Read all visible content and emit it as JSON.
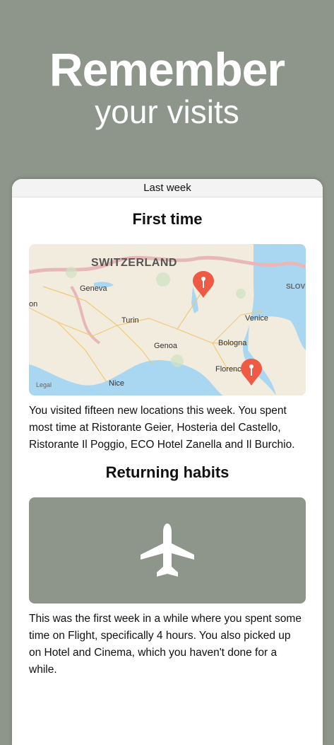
{
  "headline": {
    "line1": "Remember",
    "line2": "your visits"
  },
  "card": {
    "header": "Last week",
    "first_time": {
      "title": "First time",
      "map": {
        "country_label": "SWITZERLAND",
        "cities": [
          "Geneva",
          "Turin",
          "Genoa",
          "Nice",
          "Bologna",
          "Florence",
          "Venice"
        ],
        "partial_labels": [
          "on",
          "SLOVE",
          "Legal"
        ],
        "pins": 2
      },
      "description": "You visited fifteen new locations this week. You spent most time at Ristorante Geier, Hosteria del Castello, Ristorante Il Poggio, ECO Hotel Zanella and Il Burchio."
    },
    "returning": {
      "title": "Returning habits",
      "icon": "airplane-icon",
      "description": "This was the first week in a while where you spent some time on Flight, specifically 4 hours. You also picked up on Hotel and Cinema, which you haven't done for a while."
    }
  },
  "colors": {
    "background": "#8e958a",
    "pin": "#ee5a44",
    "water": "#a9d7f1",
    "land": "#f2ecdf"
  }
}
